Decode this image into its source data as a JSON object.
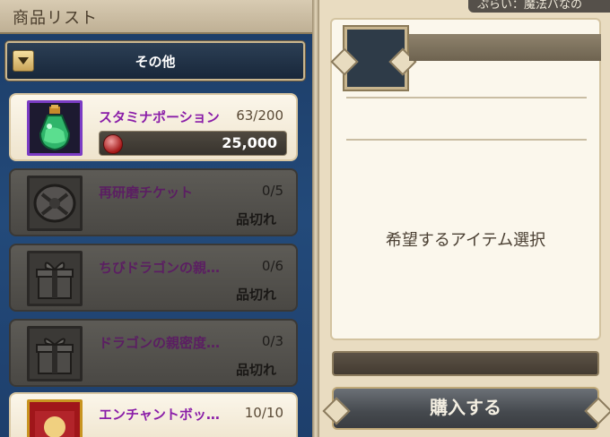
{
  "header": {
    "title": "商品リスト",
    "status_text": "ぷらい：魔法バなの"
  },
  "category": {
    "selected": "その他"
  },
  "items": [
    {
      "name": "スタミナポーション",
      "stock": "63/200",
      "price": "25,000",
      "sold_out": false,
      "icon": "potion-icon"
    },
    {
      "name": "再研磨チケット",
      "stock": "0/5",
      "status": "品切れ",
      "sold_out": true,
      "icon": "shield-ticket-icon"
    },
    {
      "name": "ちびドラゴンの親…",
      "stock": "0/6",
      "status": "品切れ",
      "sold_out": true,
      "icon": "gift-box-icon"
    },
    {
      "name": "ドラゴンの親密度…",
      "stock": "0/3",
      "status": "品切れ",
      "sold_out": true,
      "icon": "gift-box-icon"
    },
    {
      "name": "エンチャントボッ…",
      "stock": "10/10",
      "sold_out": false,
      "icon": "enchant-box-icon"
    }
  ],
  "detail": {
    "prompt": "希望するアイテム選択",
    "buy_label": "購入する"
  },
  "colors": {
    "list_bg": "#234a7a",
    "panel_bg": "#e9dcc1",
    "active_name": "#8a1da8"
  }
}
